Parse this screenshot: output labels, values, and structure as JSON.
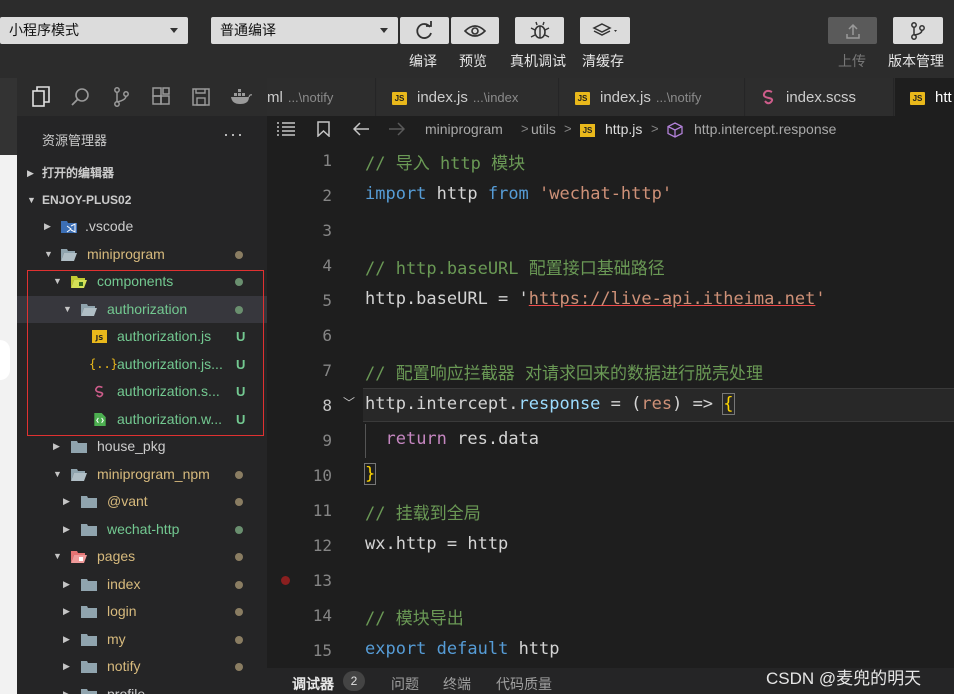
{
  "toolbar": {
    "mode_select": "小程序模式",
    "compile_select": "普通编译",
    "buttons": {
      "compile": "编译",
      "preview": "预览",
      "remote_debug": "真机调试",
      "clear_cache": "清缓存",
      "upload": "上传",
      "version": "版本管理"
    }
  },
  "tabs": [
    {
      "label": "ml",
      "desc": "...\\notify",
      "icon": "none"
    },
    {
      "label": "index.js",
      "desc": "...\\index",
      "icon": "js-file-icon"
    },
    {
      "label": "index.js",
      "desc": "...\\notify",
      "icon": "js-file-icon"
    },
    {
      "label": "index.scss",
      "desc": "",
      "icon": "sass-file-icon"
    },
    {
      "label": "htt",
      "desc": "",
      "icon": "js-file-icon"
    }
  ],
  "sidebar": {
    "title": "资源管理器",
    "more": "···",
    "open_editors": "打开的编辑器",
    "project": "ENJOY-PLUS02",
    "tree": [
      {
        "name": ".vscode",
        "icon": "vscode-folder-icon",
        "badge": ""
      },
      {
        "name": "miniprogram",
        "icon": "folder-icon",
        "badge": "dot"
      },
      {
        "name": "components",
        "icon": "components-folder-icon",
        "badge": "dot"
      },
      {
        "name": "authorization",
        "icon": "folder-icon",
        "badge": "dot"
      },
      {
        "name": "authorization.js",
        "icon": "js-file-icon",
        "badge": "U"
      },
      {
        "name": "authorization.js...",
        "icon": "json-file-icon",
        "badge": "U"
      },
      {
        "name": "authorization.s...",
        "icon": "sass-file-icon",
        "badge": "U"
      },
      {
        "name": "authorization.w...",
        "icon": "wxml-file-icon",
        "badge": "U"
      },
      {
        "name": "house_pkg",
        "icon": "folder-icon",
        "badge": ""
      },
      {
        "name": "miniprogram_npm",
        "icon": "folder-icon",
        "badge": "dot"
      },
      {
        "name": "@vant",
        "icon": "folder-icon",
        "badge": "dot"
      },
      {
        "name": "wechat-http",
        "icon": "folder-icon",
        "badge": "dot"
      },
      {
        "name": "pages",
        "icon": "pages-folder-icon",
        "badge": "dot"
      },
      {
        "name": "index",
        "icon": "folder-icon",
        "badge": "dot"
      },
      {
        "name": "login",
        "icon": "folder-icon",
        "badge": "dot"
      },
      {
        "name": "my",
        "icon": "folder-icon",
        "badge": "dot"
      },
      {
        "name": "notify",
        "icon": "folder-icon",
        "badge": "dot"
      },
      {
        "name": "profile",
        "icon": "folder-icon",
        "badge": ""
      }
    ]
  },
  "breadcrumb": {
    "seg1": "miniprogram",
    "seg2": "utils",
    "seg3": "http.js",
    "seg4": "http.intercept.response"
  },
  "code": {
    "line_numbers": [
      "1",
      "2",
      "3",
      "4",
      "5",
      "6",
      "7",
      "8",
      "9",
      "10",
      "11",
      "12",
      "13",
      "14",
      "15"
    ],
    "l1": "// 导入 http 模块",
    "l2_kw1": "import",
    "l2_var": " http ",
    "l2_kw2": "from",
    "l2_str": "'wechat-http'",
    "l4": "// http.baseURL 配置接口基础路径",
    "l5_a": "http.baseURL = '",
    "l5_url": "https://live-api.itheima.net",
    "l5_b": "'",
    "l7": "// 配置响应拦截器 对请求回来的数据进行脱壳处理",
    "l8_a": "http.intercept.",
    "l8_b": "response",
    "l8_c": " = (",
    "l8_d": "res",
    "l8_e": ") => ",
    "l8_f": "{",
    "l9_kw": "return",
    "l9_rest": " res.data",
    "l10": "}",
    "l11": "// 挂载到全局",
    "l12": "wx.http = http",
    "l14": "// 模块导出",
    "l15_kw1": "export",
    "l15_kw2": "default",
    "l15_rest": " http"
  },
  "panel": {
    "debugger": "调试器",
    "count": "2",
    "problems": "问题",
    "terminal": "终端",
    "quality": "代码质量"
  },
  "watermark": "CSDN @麦兜的明天",
  "colors": {
    "comment": "#6a9955",
    "keyword": "#569cd6",
    "string": "#ce9178",
    "added": "#73c991",
    "modified_dot": "#8a7d62",
    "highlight_box": "#e03131"
  }
}
